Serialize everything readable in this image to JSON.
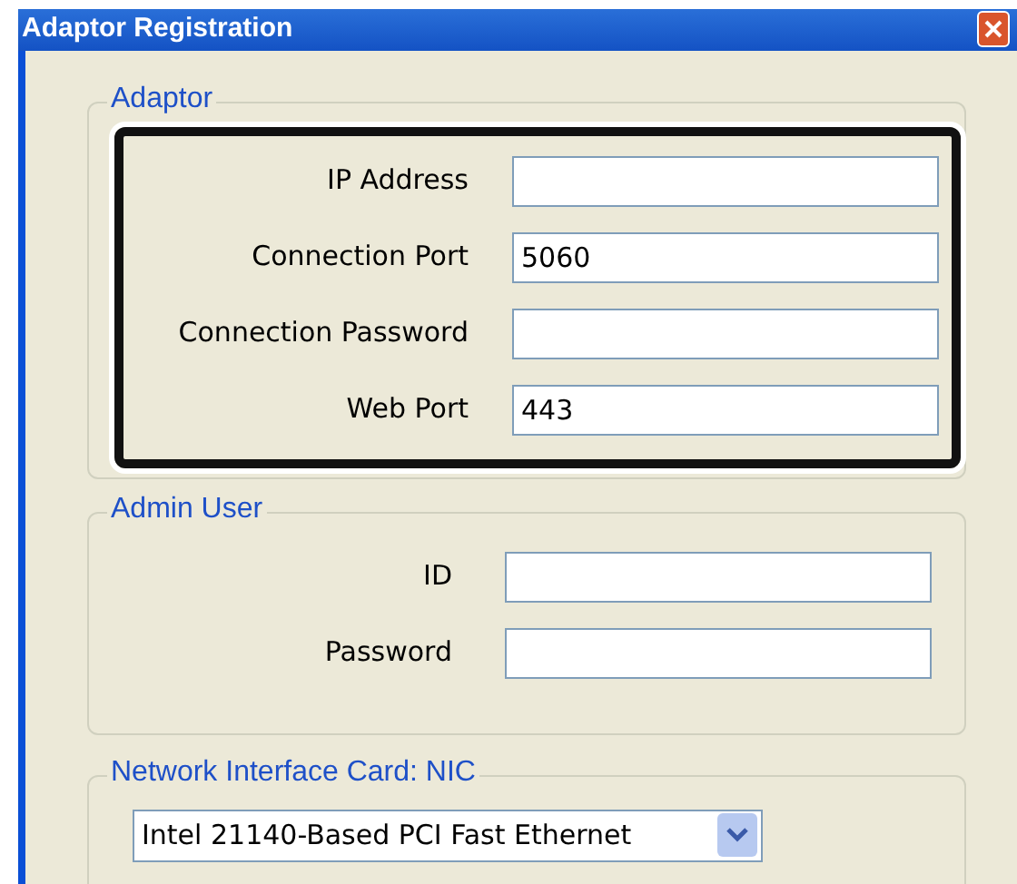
{
  "window": {
    "title": "Adaptor Registration"
  },
  "adaptor": {
    "legend": "Adaptor",
    "highlighted": true,
    "fields": [
      {
        "label": "IP Address"
      },
      {
        "label": "Connection Port",
        "value": "5060"
      },
      {
        "label": "Connection Password"
      },
      {
        "label": "Web Port",
        "value": "443"
      }
    ]
  },
  "admin_user": {
    "legend": "Admin User",
    "fields": [
      {
        "label": "ID"
      },
      {
        "label": "Password"
      }
    ]
  },
  "nic": {
    "legend": "Network Interface Card: NIC",
    "selected_value": "Intel 21140-Based PCI Fast Ethernet"
  }
}
